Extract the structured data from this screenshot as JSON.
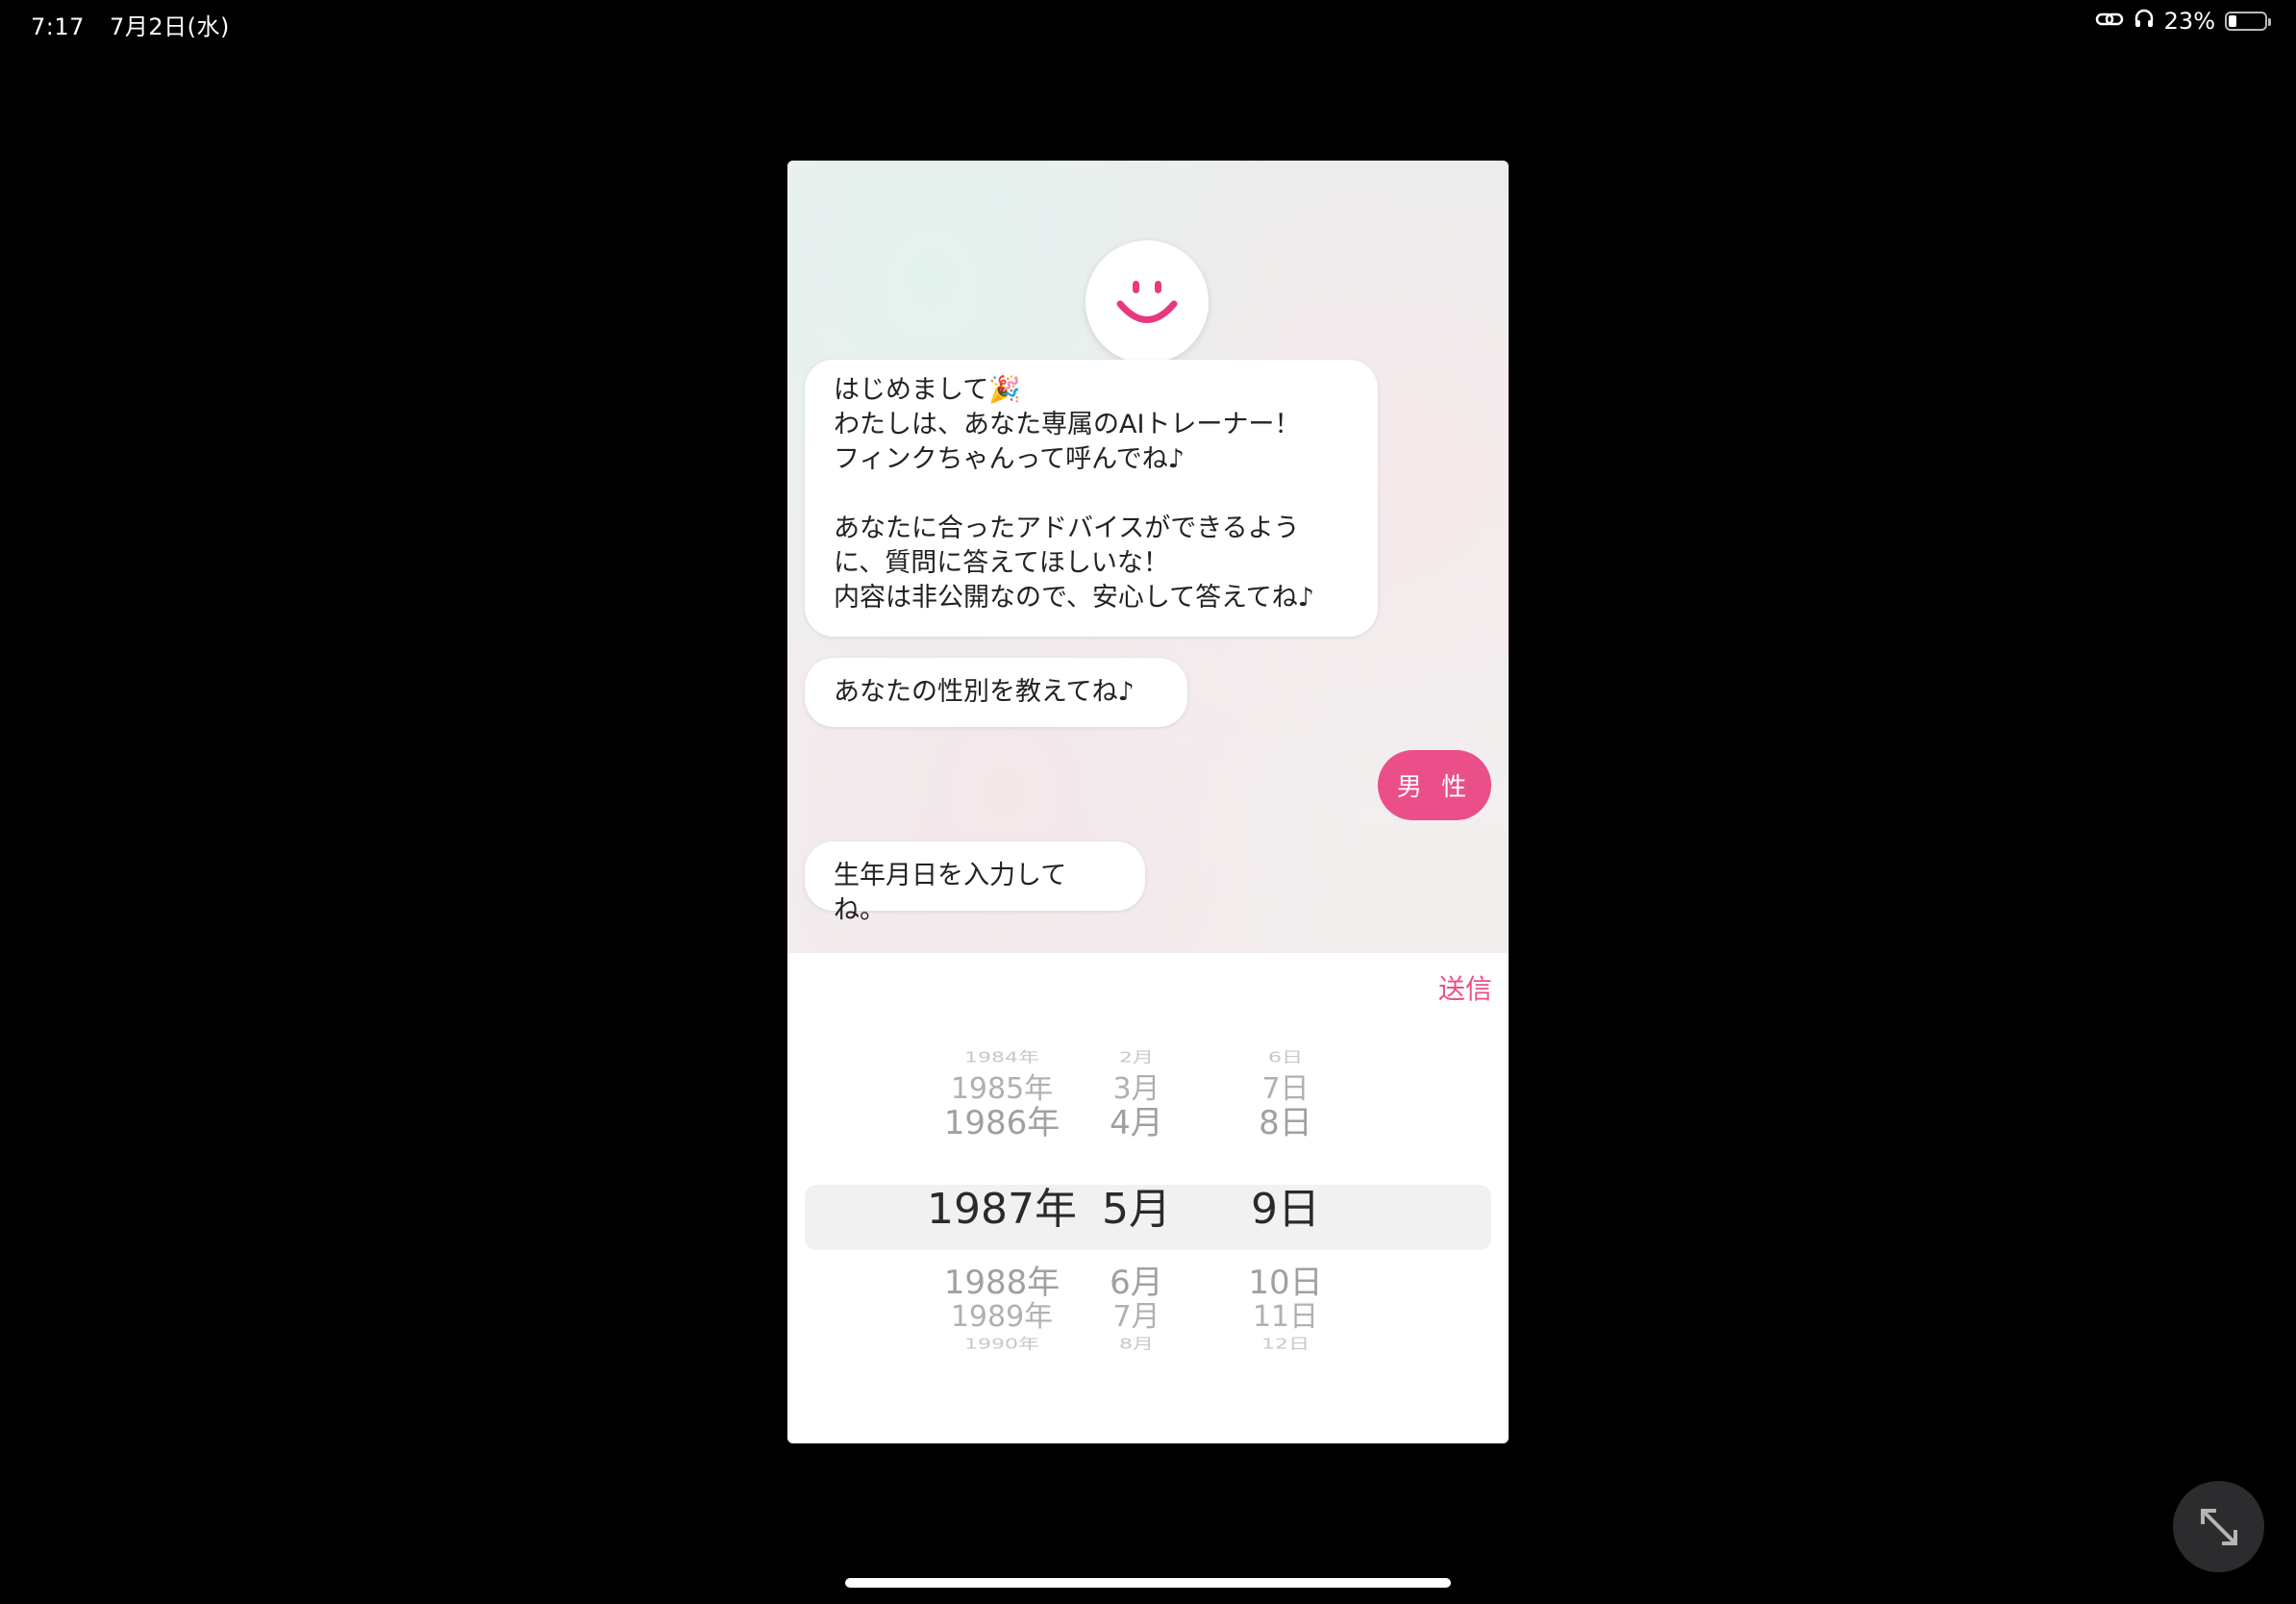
{
  "status": {
    "time": "7:17",
    "date": "7月2日(水)",
    "battery": "23%",
    "battery_level": 0.23,
    "icons": [
      "link-icon",
      "headphones-icon",
      "battery-icon"
    ]
  },
  "chat": {
    "avatar_icon": "smiley-icon",
    "messages": [
      {
        "text": "はじめまして🎉\nわたしは、あなた専属のAIトレーナー！\nフィンクちゃんって呼んでね♪\n\nあなたに合ったアドバイスができるように、質問に答えてほしいな！\n内容は非公開なので、安心して答えてね♪"
      },
      {
        "text": "あなたの性別を教えてね♪"
      },
      {
        "text": "生年月日を入力してね。"
      }
    ],
    "reply": "男 性"
  },
  "input": {
    "send_label": "送信",
    "years": [
      "1984年",
      "1985年",
      "1986年",
      "1987年",
      "1988年",
      "1989年",
      "1990年"
    ],
    "months": [
      "2月",
      "3月",
      "4月",
      "5月",
      "6月",
      "7月",
      "8月"
    ],
    "days": [
      "6日",
      "7日",
      "8日",
      "9日",
      "10日",
      "11日",
      "12日"
    ],
    "selected": {
      "year": "1987年",
      "month": "5月",
      "day": "9日"
    }
  },
  "colors": {
    "accent": "#ea4f89",
    "background": "#000000"
  },
  "controls": {
    "expand_icon": "expand-arrows-icon"
  }
}
